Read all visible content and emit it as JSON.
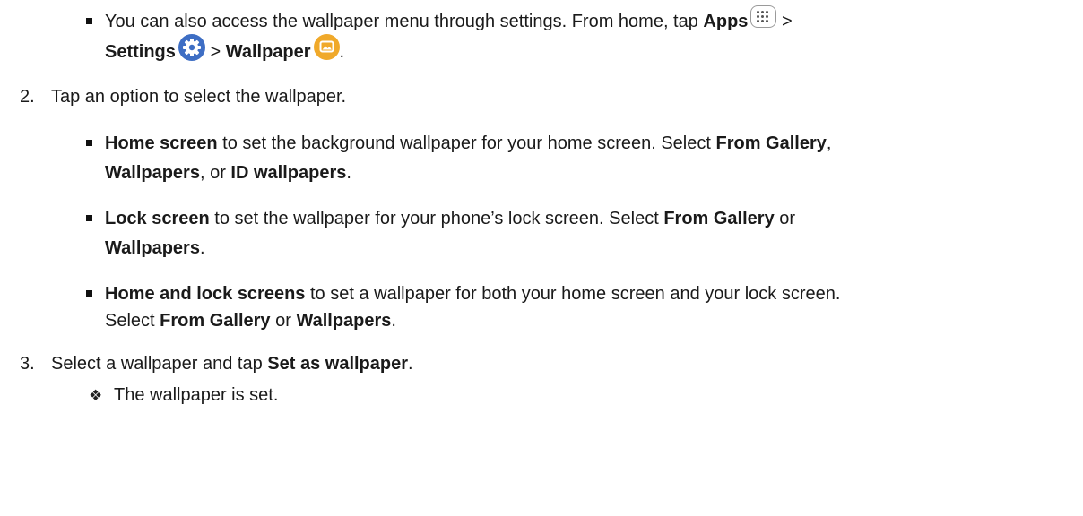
{
  "bullets": {
    "access": {
      "text1": "You can also access the wallpaper menu through settings. From home, tap ",
      "apps": "Apps",
      "gt1": " >",
      "settings": "Settings",
      "gt2": " > ",
      "wallpaper": "Wallpaper",
      "period": "."
    },
    "home": {
      "bold1": "Home screen",
      "text1": " to set the background wallpaper for your home screen. Select ",
      "bold2": "From Gallery",
      "comma": ",",
      "bold3": "Wallpapers",
      "text2": ", or ",
      "bold4": "ID wallpapers",
      "period": "."
    },
    "lock": {
      "bold1": "Lock screen",
      "text1": " to set the wallpaper for your phone’s lock screen. Select ",
      "bold2": "From Gallery",
      "text2": " or",
      "bold3": "Wallpapers",
      "period": "."
    },
    "both": {
      "bold1": "Home and lock screens",
      "text1": " to set a wallpaper for both your home screen and your lock screen.",
      "text2": "Select ",
      "bold2": "From Gallery",
      "text3": " or ",
      "bold3": "Wallpapers",
      "period": "."
    }
  },
  "steps": {
    "step2": {
      "number": "2.",
      "text": "Tap an option to select the wallpaper."
    },
    "step3": {
      "number": "3.",
      "text1": "Select a wallpaper and tap ",
      "bold1": "Set as wallpaper",
      "period": "."
    }
  },
  "result": {
    "text": "The wallpaper is set."
  },
  "icons": {
    "apps": "apps-grid-icon",
    "settings": "settings-gear-icon",
    "wallpaper": "wallpaper-image-icon"
  },
  "colors": {
    "text": "#1a1a1a",
    "settings_icon": "#3e6ec4",
    "wallpaper_icon": "#f0a92a"
  }
}
